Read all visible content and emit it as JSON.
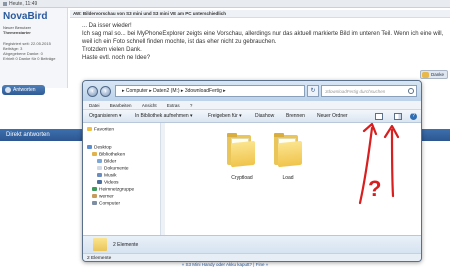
{
  "forum": {
    "timestamp": "Heute, 11:49",
    "username": "NovaBird",
    "user_role_1": "Neuer Benutzer",
    "user_role_2": "Themenstarter",
    "registered": "Registriert seit: 22.05.2015",
    "posts": "Beiträge: 3",
    "thanks_given": "Abgegebene Danke: 0",
    "thanks_received": "Erhielt 0 Danke für 0 Beiträge",
    "post_title": "AW: Bildervorschau von S3 mini und S3 mini VE am PC unterschiedlich",
    "post_line_1": "... Da isser wieder!",
    "post_line_2": "Ich sag mal so... bei MyPhoneExplorer zeigts eine Vorschau, allerdings nur das aktuell markierte Bild im unteren Teil. Wenn ich eine will, weil ich ein Foto schnell finden mochte, ist das eher nicht zu gebrauchen.",
    "post_line_3": "Trotzdem vielen Dank.",
    "post_line_4": "Haste evtl. noch ne Idee?",
    "danke_label": "Danke",
    "antworten_label": "Antworten",
    "direkt_label": "Direkt antworten",
    "footer_link": "« S3 Mini Handy oder Akku kaputt? | Fine »"
  },
  "explorer": {
    "address": "▸ Computer ▸ Daten2 (M:) ▸ 3downloadFertig ▸",
    "search_placeholder": "3downloadFertig durchsuchen",
    "menu": [
      "Datei",
      "Bearbeiten",
      "Ansicht",
      "Extras",
      "?"
    ],
    "commands": [
      "Organisieren ▾",
      "In Bibliothek aufnehmen ▾",
      "Freigeben für ▾",
      "Diashow",
      "Brennen",
      "Neuer Ordner"
    ],
    "tree": {
      "favoriten": "Favoriten",
      "desktop": "Desktop",
      "bibliotheken": "Bibliotheken",
      "bilder": "Bilder",
      "dokumente": "Dokumente",
      "musik": "Musik",
      "videos": "Videos",
      "heimnetzgruppe": "Heimnetzgruppe",
      "werner": "werner",
      "computer": "Computer"
    },
    "folders": [
      "Cryptload",
      "Load"
    ],
    "details_count": "2 Elemente",
    "status_count": "2 Elemente"
  },
  "annotation": {
    "question_mark": "?",
    "color": "#d81e1e"
  }
}
